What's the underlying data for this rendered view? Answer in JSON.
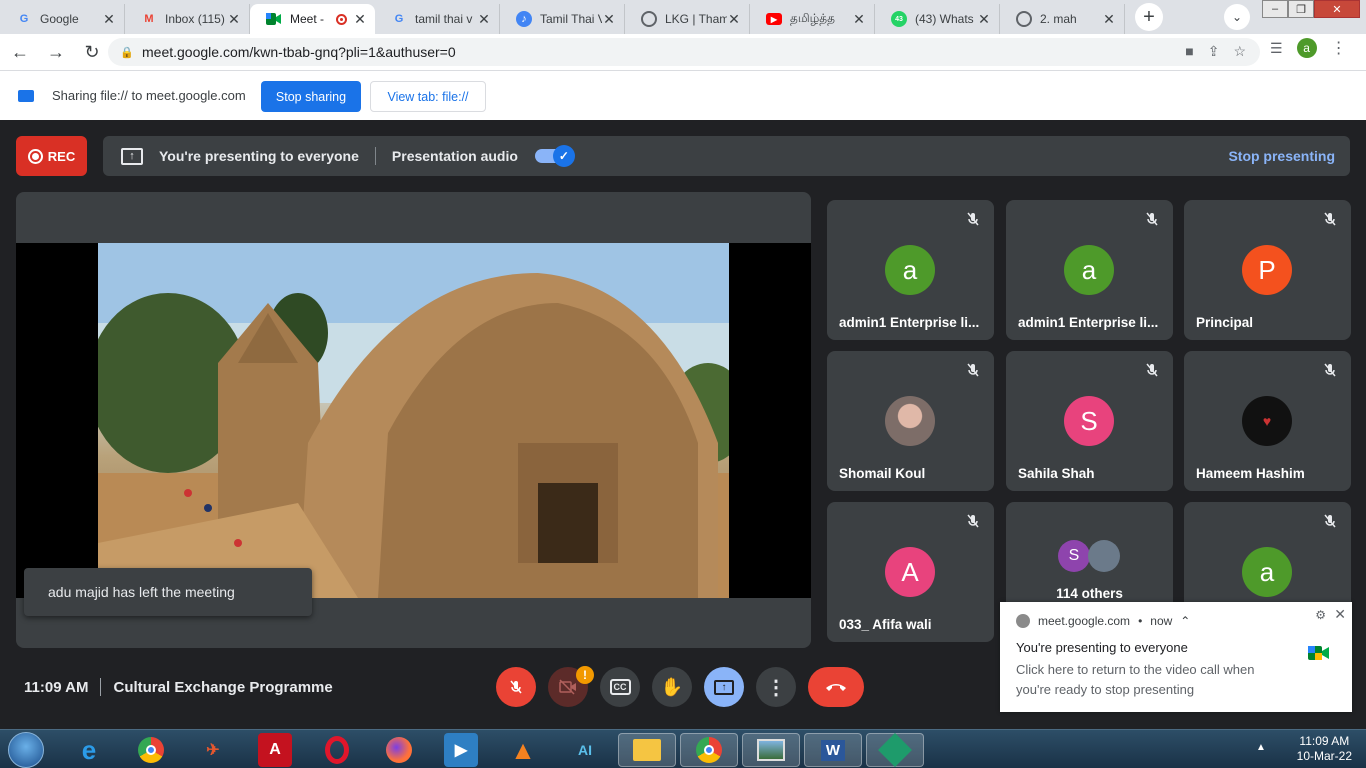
{
  "browser": {
    "tabs": [
      {
        "title": "Google",
        "icon": "google-icon",
        "color": "#4285f4"
      },
      {
        "title": "Inbox (115)",
        "icon": "gmail-icon",
        "color": "#ea4335"
      },
      {
        "title": "Meet -",
        "icon": "meet-icon",
        "color": "#00832d",
        "active": true
      },
      {
        "title": "tamil thai v",
        "icon": "google-icon",
        "color": "#4285f4"
      },
      {
        "title": "Tamil Thai V",
        "icon": "music-icon",
        "color": "#4285f4"
      },
      {
        "title": "LKG | Tham",
        "icon": "globe-icon",
        "color": "#5f6368"
      },
      {
        "title": "தமிழ்த்த",
        "icon": "youtube-icon",
        "color": "#ff0000"
      },
      {
        "title": "(43) Whats",
        "icon": "whatsapp-icon",
        "color": "#25d366"
      },
      {
        "title": "2. mah",
        "icon": "globe-icon",
        "color": "#5f6368"
      }
    ],
    "url": "meet.google.com/kwn-tbab-gnq?pli=1&authuser=0",
    "profile_initial": "a",
    "whatsapp_count": "43"
  },
  "sharebar": {
    "text": "Sharing file:// to meet.google.com",
    "stop_label": "Stop sharing",
    "view_label": "View tab: file://"
  },
  "meet": {
    "rec_label": "REC",
    "presenting_text": "You're presenting to everyone",
    "audio_label": "Presentation audio",
    "stop_presenting": "Stop presenting",
    "toast": "adu majid has left the meeting",
    "time": "11:09 AM",
    "meeting_title": "Cultural Exchange Programme",
    "participants": [
      {
        "name": "admin1 Enterprise li...",
        "initial": "a",
        "color": "#4e9a2a"
      },
      {
        "name": "admin1 Enterprise li...",
        "initial": "a",
        "color": "#4e9a2a"
      },
      {
        "name": "Principal",
        "initial": "P",
        "color": "#f4511e"
      },
      {
        "name": "Shomail Koul",
        "initial": "",
        "color": "#8a7d78"
      },
      {
        "name": "Sahila Shah",
        "initial": "S",
        "color": "#e8437d"
      },
      {
        "name": "Hameem Hashim",
        "initial": "",
        "color": "#111111"
      },
      {
        "name": "033_ Afifa wali",
        "initial": "A",
        "color": "#e8437d"
      },
      {
        "name": "114 others",
        "initial": "S",
        "color": "#8e44ad"
      },
      {
        "name": "",
        "initial": "a",
        "color": "#4e9a2a"
      }
    ],
    "badge": "!"
  },
  "notification": {
    "source": "meet.google.com",
    "when": "now",
    "title": "You're presenting to everyone",
    "body": "Click here to return to the video call when you're ready to stop presenting"
  },
  "taskbar": {
    "time": "11:09 AM",
    "date": "10-Mar-22"
  }
}
